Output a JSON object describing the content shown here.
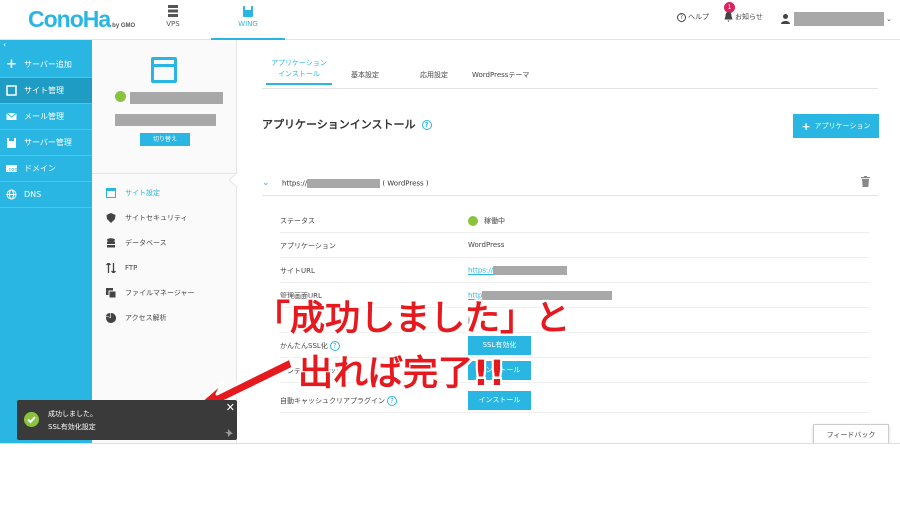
{
  "topbar": {
    "logo": "ConoHa",
    "logo_sub": "by GMO",
    "nav": [
      {
        "label": "VPS",
        "icon": "server-icon"
      },
      {
        "label": "WING",
        "icon": "wing-icon"
      }
    ],
    "help_label": "ヘルプ",
    "notice_label": "お知らせ",
    "notice_count": "1"
  },
  "sidebar": {
    "collapse": "‹",
    "items": [
      {
        "label": "サーバー追加",
        "icon": "plus-icon"
      },
      {
        "label": "サイト管理",
        "icon": "site-icon"
      },
      {
        "label": "メール管理",
        "icon": "mail-icon"
      },
      {
        "label": "サーバー管理",
        "icon": "server-icon"
      },
      {
        "label": "ドメイン",
        "icon": "domain-icon"
      },
      {
        "label": "DNS",
        "icon": "globe-icon"
      }
    ]
  },
  "panel": {
    "switch_label": "切り替え",
    "menu": [
      {
        "label": "サイト設定",
        "icon": "window-icon"
      },
      {
        "label": "サイトセキュリティ",
        "icon": "shield-icon"
      },
      {
        "label": "データベース",
        "icon": "database-icon"
      },
      {
        "label": "FTP",
        "icon": "transfer-icon"
      },
      {
        "label": "ファイルマネージャー",
        "icon": "files-icon"
      },
      {
        "label": "アクセス解析",
        "icon": "pie-icon"
      }
    ]
  },
  "tabs": [
    {
      "label": "アプリケーション\nインストール"
    },
    {
      "label": "基本設定"
    },
    {
      "label": "応用設定"
    },
    {
      "label": "WordPressテーマ"
    }
  ],
  "main": {
    "title": "アプリケーションインストール",
    "add_button": "アプリケーション",
    "acc_prefix": "https://",
    "acc_suffix": "( WordPress )",
    "rows": {
      "status_k": "ステータス",
      "status_v": "稼働中",
      "app_k": "アプリケーション",
      "app_v": "WordPress",
      "siteurl_k": "サイトURL",
      "siteurl_v": "https://",
      "admin_k": "管理画面URL",
      "admin_v": "http",
      "jp_v": "jx",
      "ssl_k": "かんたんSSL化",
      "ssl_btn": "SSL有効化",
      "cont_k": "コンテンツキャッシュ",
      "cont_btn": "インストール",
      "cache_k": "自動キャッシュクリアプラグイン",
      "cache_btn": "インストール"
    },
    "feedback": "フィードバック"
  },
  "toast": {
    "line1": "成功しました。",
    "line2": "SSL有効化設定",
    "close": "✕"
  },
  "annotation": {
    "line1": "「成功しました」と",
    "line2": "出れば完了!!"
  }
}
